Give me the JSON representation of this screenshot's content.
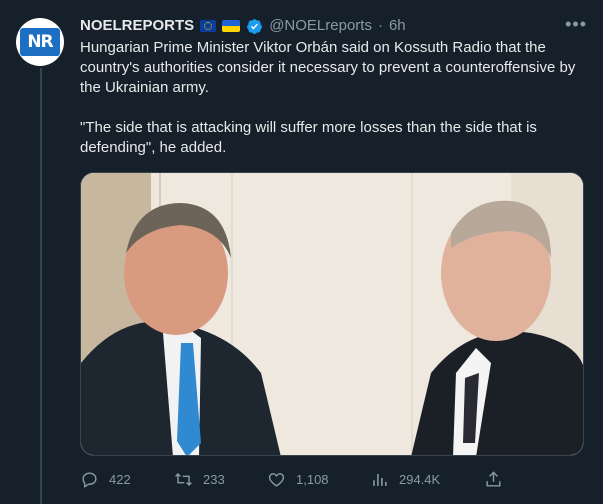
{
  "author": {
    "avatar_text": "NR",
    "name": "NOELREPORTS",
    "handle": "@NOELreports",
    "separator": "·",
    "time": "6h"
  },
  "body": {
    "paragraph1": "Hungarian Prime Minister Viktor Orbán said on Kossuth Radio that the country's authorities consider it necessary to prevent a counteroffensive by the Ukrainian army.",
    "paragraph2": "\"The side that is attacking will suffer more losses than the side that is defending\", he added."
  },
  "actions": {
    "replies": "422",
    "retweets": "233",
    "likes": "1,108",
    "views": "294.4K"
  },
  "icons": {
    "more": "more-icon",
    "reply": "reply-icon",
    "retweet": "retweet-icon",
    "like": "heart-icon",
    "views": "views-icon",
    "share": "share-icon"
  },
  "colors": {
    "background": "#15202b",
    "text": "#e7e9ea",
    "muted": "#8b98a5",
    "verified": "#1d9bf0",
    "border": "#38444d"
  }
}
